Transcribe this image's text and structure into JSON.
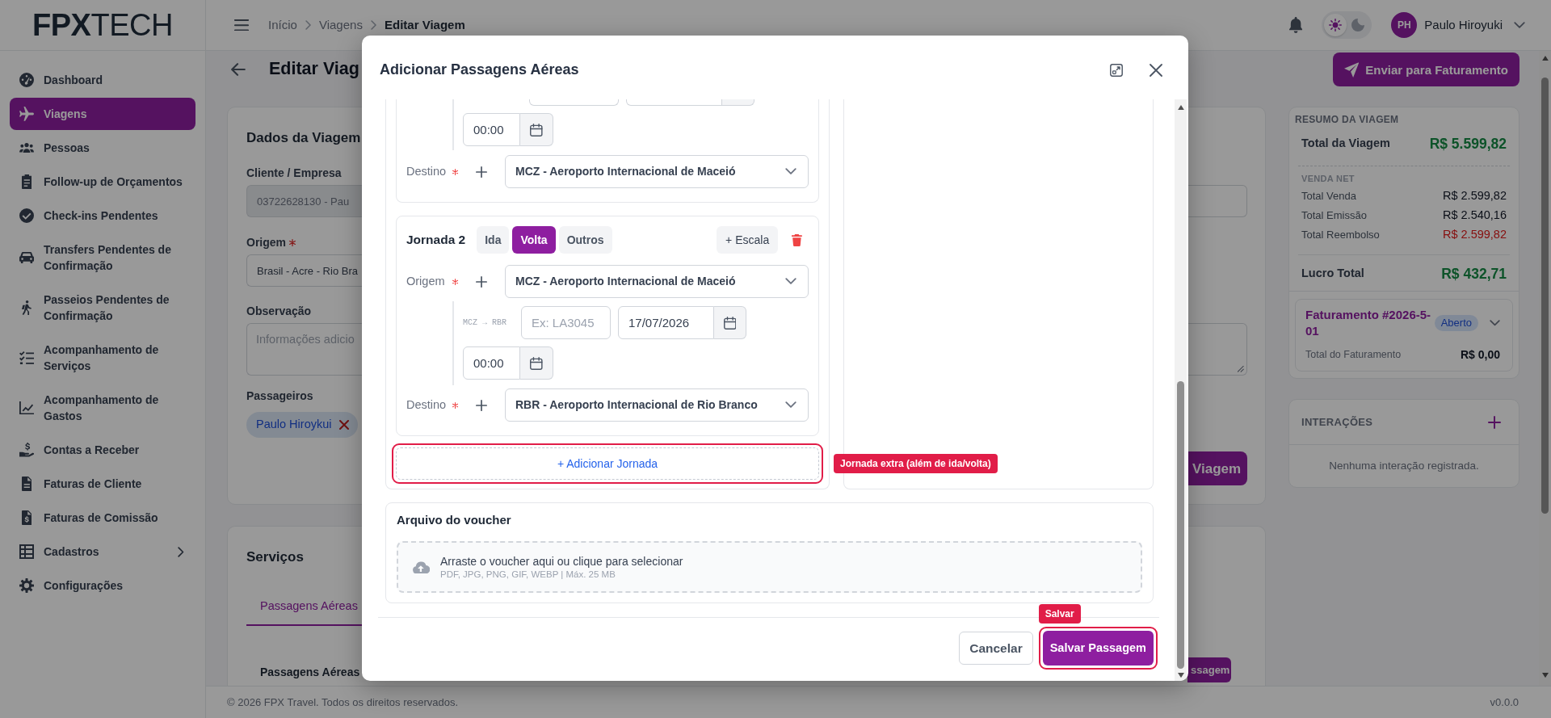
{
  "sidebar": {
    "logo": "**FPX**TECH",
    "items": [
      {
        "label": "Dashboard",
        "kind": "link",
        "selected": false
      },
      {
        "label": "Viagens",
        "kind": "link",
        "selected": true
      },
      {
        "label": "Pessoas",
        "kind": "link",
        "selected": false
      },
      {
        "label": "Follow-up de Orçamentos",
        "kind": "link",
        "selected": false
      },
      {
        "label": "Check-ins Pendentes",
        "kind": "link",
        "selected": false
      },
      {
        "label": "Transfers Pendentes de Confirmação",
        "kind": "link",
        "selected": false
      },
      {
        "label": "Passeios Pendentes de Confirmação",
        "kind": "link",
        "selected": false
      },
      {
        "label": "Acompanhamento de Serviços",
        "kind": "link",
        "selected": false
      },
      {
        "label": "Acompanhamento de Gastos",
        "kind": "link",
        "selected": false
      },
      {
        "label": "Contas a Receber",
        "kind": "link",
        "selected": false
      },
      {
        "label": "Faturas de Cliente",
        "kind": "link",
        "selected": false
      },
      {
        "label": "Faturas de Comissão",
        "kind": "link",
        "selected": false
      },
      {
        "label": "Cadastros",
        "kind": "group",
        "selected": false,
        "expanded": false
      },
      {
        "label": "Configurações",
        "kind": "link",
        "selected": false
      }
    ]
  },
  "header": {
    "breadcrumb": [
      {
        "label": "Início",
        "current": false
      },
      {
        "label": "Viagens",
        "current": false
      },
      {
        "label": "Editar Viagem",
        "current": true
      }
    ],
    "theme": [
      {
        "kind": "light",
        "selected": true
      },
      {
        "kind": "dark",
        "selected": false
      }
    ],
    "user": {
      "initials": "PH",
      "name": "Paulo Hiroyuki"
    }
  },
  "page": {
    "title": "Editar Viag",
    "action": "Enviar para Faturamento"
  },
  "trip_card": {
    "title": "Dados da Viagem",
    "fields": [
      {
        "kind": "input",
        "label": "Cliente / Empresa",
        "value": "03722628130 - Pau",
        "required": false,
        "disabled": true
      },
      {
        "kind": "input",
        "label": "Origem",
        "value": "Brasil - Acre - Rio Bra",
        "required": true,
        "disabled": false
      },
      {
        "kind": "textarea",
        "label": "Observação",
        "placeholder": "Informações adicio",
        "required": false,
        "disabled": false
      }
    ],
    "passengers_label": "Passageiros",
    "passengers": [
      {
        "name": "Paulo Hiroykui"
      }
    ],
    "button": "Viagem"
  },
  "services_card": {
    "title": "Serviços",
    "tabs": [
      {
        "label": "Passagens Aéreas",
        "selected": true
      }
    ],
    "section_title": "Passagens Aéreas",
    "button": "ssagem"
  },
  "summary": {
    "title": "RESUMO DA VIAGEM",
    "total": {
      "label": "Total da Viagem",
      "value": "R$ 5.599,82"
    },
    "section": "VENDA NET",
    "rows": [
      {
        "label": "Total Venda",
        "value": "R$ 2.599,82",
        "kind": "amount"
      },
      {
        "label": "Total Emissão",
        "value": "R$ 2.540,16",
        "kind": "amount"
      },
      {
        "label": "Total Reembolso",
        "value": "R$ 2.599,82",
        "kind": "refund"
      }
    ],
    "profit": {
      "label": "Lucro Total",
      "value": "R$ 432,71"
    },
    "invoice": {
      "title": "Faturamento #2026-5-01",
      "status": "Aberto",
      "expanded": false,
      "total_label": "Total do Faturamento",
      "total_value": "R$ 0,00"
    }
  },
  "interactions": {
    "title": "INTERAÇÕES",
    "empty_text": "Nenhuma interação registrada."
  },
  "footer": {
    "copyright": "© 2026 FPX Travel. Todos os direitos reservados.",
    "version": "v0.0.0"
  },
  "modal": {
    "title": "Adicionar Passagens Aéreas",
    "journeys": [
      {
        "kind": "partial",
        "segments": [
          {
            "time": "00:00"
          }
        ],
        "destination": {
          "label": "Destino",
          "required": true,
          "value": "MCZ - Aeroporto Internacional de Maceió"
        }
      },
      {
        "kind": "full",
        "title": "Jornada 2",
        "types": [
          {
            "label": "Ida",
            "selected": false
          },
          {
            "label": "Volta",
            "selected": true
          },
          {
            "label": "Outros",
            "selected": false
          }
        ],
        "add_stop": "+ Escala",
        "origin": {
          "label": "Origem",
          "required": true,
          "value": "MCZ - Aeroporto Internacional de Maceió"
        },
        "segments": [
          {
            "route": "MCZ → RBR",
            "flight_placeholder": "Ex: LA3045",
            "date": "17/07/2026",
            "time": "00:00"
          }
        ],
        "destination": {
          "label": "Destino",
          "required": true,
          "value": "RBR - Aeroporto Internacional de Rio Branco"
        }
      }
    ],
    "add_journey": {
      "label": "+ Adicionar Jornada",
      "highlight": "Jornada extra (além de ida/volta)"
    },
    "voucher": {
      "title": "Arquivo do voucher",
      "prompt": "Arraste o voucher aqui ou clique para selecionar",
      "hint": "PDF, JPG, PNG, GIF, WEBP | Máx. 25 MB"
    },
    "buttons": [
      {
        "label": "Cancelar",
        "kind": "secondary"
      },
      {
        "label": "Salvar Passagem",
        "kind": "primary",
        "highlight": "Salvar"
      }
    ]
  }
}
